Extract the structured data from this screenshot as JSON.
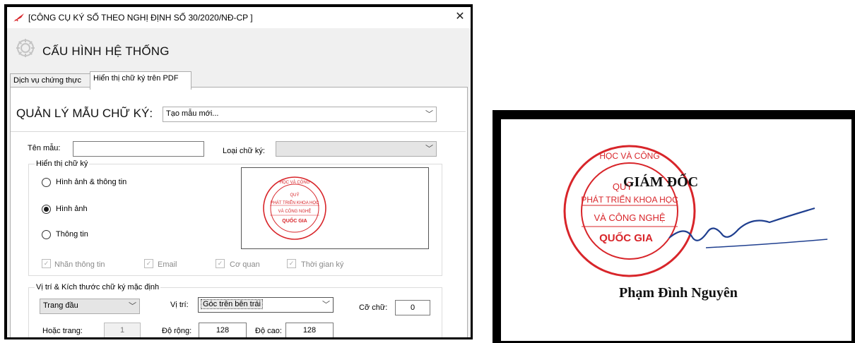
{
  "window": {
    "title": "[CÔNG CỤ KÝ SỐ THEO NGHỊ ĐỊNH SỐ 30/2020/NĐ-CP ]",
    "close_glyph": "✕",
    "header_title": "CẤU HÌNH HỆ THỐNG",
    "app_icon": "pen-icon",
    "header_icon": "gear-icon"
  },
  "tabs": [
    {
      "label": "Dịch vụ chứng thực",
      "active": false
    },
    {
      "label": "Hiển thị chữ ký trên PDF",
      "active": true
    }
  ],
  "manager": {
    "label": "QUẢN LÝ MẪU CHỮ KÝ:",
    "selected": "Tạo mẫu mới..."
  },
  "template": {
    "name_label": "Tên mẫu:",
    "name_value": "",
    "type_label": "Loại chữ ký:",
    "type_value": ""
  },
  "display_group": {
    "legend": "Hiển thị chữ ký",
    "options": [
      {
        "label": "Hình ảnh & thông tin",
        "selected": false
      },
      {
        "label": "Hình ảnh",
        "selected": true
      },
      {
        "label": "Thông tin",
        "selected": false
      }
    ],
    "checkboxes": [
      {
        "label": "Nhãn thông tin",
        "checked": true
      },
      {
        "label": "Email",
        "checked": true
      },
      {
        "label": "Cơ quan",
        "checked": true
      },
      {
        "label": "Thời gian ký",
        "checked": true
      }
    ]
  },
  "stamp": {
    "arc_top": "HỌC  VÀ  CÔNG",
    "line1": "QUỸ",
    "line2": "PHÁT TRIỂN KHOA HỌC",
    "line3": "VÀ CÔNG NGHỆ",
    "line4": "QUỐC GIA"
  },
  "position_group": {
    "legend": "Vị trí  & Kích thước chữ ký mặc định",
    "page_value": "Trang đầu",
    "position_label": "Vị trí:",
    "position_value": "Góc trên bên trái",
    "font_size_label": "Cỡ chữ:",
    "font_size_value": "0",
    "or_page_label": "Hoặc trang:",
    "or_page_value": "1",
    "width_label": "Độ rộng:",
    "width_value": "128",
    "height_label": "Độ cao:",
    "height_value": "128"
  },
  "signature": {
    "role": "GIÁM ĐỐC",
    "name": "Phạm Đình Nguyên",
    "stamp_color": "#d8252a",
    "ink_color": "#1f3f8f"
  },
  "colors": {
    "window_bg": "#f0f0f0",
    "accent_red": "#d8252a"
  }
}
